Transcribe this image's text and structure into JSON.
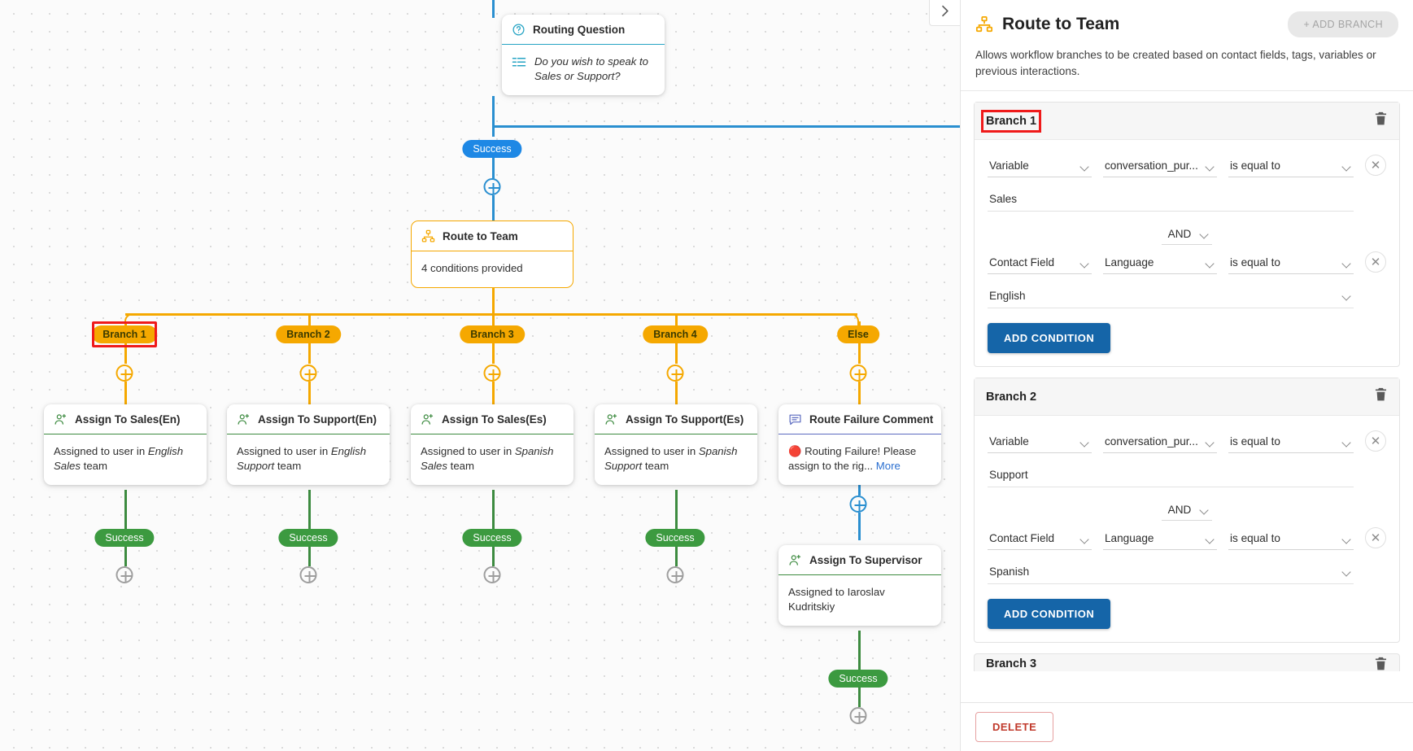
{
  "canvas": {
    "collapse_icon": "chevron-right-icon",
    "nodes": {
      "routing_question": {
        "title": "Routing Question",
        "icon": "question-circle-icon",
        "body_icon": "list-icon",
        "body": "Do you wish to speak to Sales or Support?"
      },
      "route_to_team": {
        "title": "Route to Team",
        "icon": "sitemap-icon",
        "body": "4 conditions provided"
      },
      "assign_sales_en": {
        "title": "Assign To Sales(En)",
        "icon": "user-plus-icon",
        "body_prefix": "Assigned to user in ",
        "body_em": "English Sales",
        "body_suffix": " team"
      },
      "assign_support_en": {
        "title": "Assign To Support(En)",
        "icon": "user-plus-icon",
        "body_prefix": "Assigned to user in ",
        "body_em": "English Support",
        "body_suffix": " team"
      },
      "assign_sales_es": {
        "title": "Assign To Sales(Es)",
        "icon": "user-plus-icon",
        "body_prefix": "Assigned to user in ",
        "body_em": "Spanish Sales",
        "body_suffix": " team"
      },
      "assign_support_es": {
        "title": "Assign To Support(Es)",
        "icon": "user-plus-icon",
        "body_prefix": "Assigned to user in ",
        "body_em": "Spanish Support",
        "body_suffix": " team"
      },
      "route_failure_comment": {
        "title": "Route Failure Comment",
        "icon": "comment-icon",
        "emoji": "🔴",
        "body": "Routing Failure! Please assign to the rig...",
        "more_label": "More"
      },
      "assign_supervisor": {
        "title": "Assign To Supervisor",
        "icon": "user-plus-icon",
        "body": "Assigned to Iaroslav Kudritskiy"
      }
    },
    "labels": {
      "success_top": "Success",
      "branch_1": "Branch 1",
      "branch_2": "Branch 2",
      "branch_3": "Branch 3",
      "branch_4": "Branch 4",
      "else": "Else",
      "success_1": "Success",
      "success_2": "Success",
      "success_3": "Success",
      "success_4": "Success",
      "success_5": "Success"
    }
  },
  "panel": {
    "icon": "sitemap-icon",
    "title": "Route to Team",
    "add_branch_label": "+ ADD BRANCH",
    "description": "Allows workflow branches to be created based on contact fields, tags, variables or previous interactions.",
    "delete_label": "DELETE",
    "trash_icon": "trash-icon",
    "close_icon": "close-icon",
    "add_condition_label": "ADD CONDITION",
    "branches": [
      {
        "name": "Branch 1",
        "highlighted": true,
        "conditions": [
          {
            "source": "Variable",
            "field": "conversation_pur...",
            "operator": "is equal to",
            "value": "Sales",
            "value_has_chevron": false
          },
          {
            "source": "Contact Field",
            "field": "Language",
            "operator": "is equal to",
            "value": "English",
            "value_has_chevron": true
          }
        ],
        "joiner": "AND"
      },
      {
        "name": "Branch 2",
        "highlighted": false,
        "conditions": [
          {
            "source": "Variable",
            "field": "conversation_pur...",
            "operator": "is equal to",
            "value": "Support",
            "value_has_chevron": false
          },
          {
            "source": "Contact Field",
            "field": "Language",
            "operator": "is equal to",
            "value": "Spanish",
            "value_has_chevron": true
          }
        ],
        "joiner": "AND"
      }
    ],
    "clipped_branch_name": "Branch 3"
  },
  "colors": {
    "blue": "#1e88e5",
    "amber": "#f5a800",
    "green": "#3c9a40",
    "red_highlight": "#ef1a1a",
    "primary_button": "#1565a8"
  }
}
